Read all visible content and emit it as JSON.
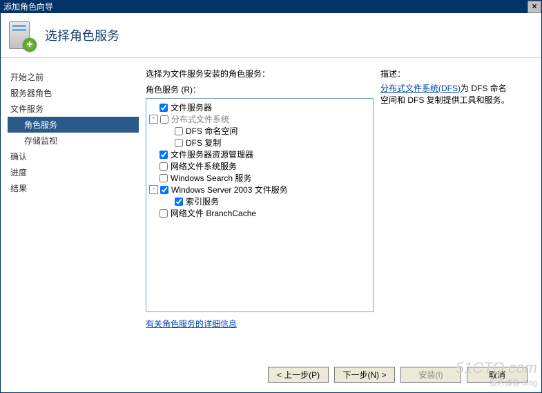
{
  "titlebar": {
    "text": "添加角色向导"
  },
  "header": {
    "title": "选择角色服务"
  },
  "sidebar": {
    "items": [
      {
        "label": "开始之前",
        "indent": false,
        "selected": false
      },
      {
        "label": "服务器角色",
        "indent": false,
        "selected": false
      },
      {
        "label": "文件服务",
        "indent": false,
        "selected": false
      },
      {
        "label": "角色服务",
        "indent": true,
        "selected": true
      },
      {
        "label": "存储监视",
        "indent": true,
        "selected": false
      },
      {
        "label": "确认",
        "indent": false,
        "selected": false
      },
      {
        "label": "进度",
        "indent": false,
        "selected": false
      },
      {
        "label": "结果",
        "indent": false,
        "selected": false
      }
    ]
  },
  "main": {
    "instruction": "选择为文件服务安装的角色服务：",
    "sublabel": "角色服务 (R)：",
    "tree": [
      {
        "indent": 0,
        "expander": "",
        "checked": true,
        "gray": false,
        "label": "文件服务器"
      },
      {
        "indent": 0,
        "expander": "-",
        "checked": false,
        "gray": true,
        "label": "分布式文件系统"
      },
      {
        "indent": 1,
        "expander": "",
        "checked": false,
        "gray": false,
        "label": "DFS 命名空间"
      },
      {
        "indent": 1,
        "expander": "",
        "checked": false,
        "gray": false,
        "label": "DFS 复制"
      },
      {
        "indent": 0,
        "expander": "",
        "checked": true,
        "gray": false,
        "label": "文件服务器资源管理器"
      },
      {
        "indent": 0,
        "expander": "",
        "checked": false,
        "gray": false,
        "label": "网络文件系统服务"
      },
      {
        "indent": 0,
        "expander": "",
        "checked": false,
        "gray": false,
        "label": "Windows Search 服务"
      },
      {
        "indent": 0,
        "expander": "-",
        "checked": true,
        "gray": false,
        "label": "Windows Server 2003 文件服务"
      },
      {
        "indent": 1,
        "expander": "",
        "checked": true,
        "gray": false,
        "label": "索引服务"
      },
      {
        "indent": 0,
        "expander": "",
        "checked": false,
        "gray": false,
        "label": "网络文件 BranchCache"
      }
    ],
    "detail_link": "有关角色服务的详细信息"
  },
  "description": {
    "title": "描述：",
    "link": "分布式文件系统(DFS)",
    "rest1": "为 DFS 命名",
    "rest2": "空间和 DFS 复制提供工具和服务。"
  },
  "buttons": {
    "prev": "< 上一步(P)",
    "next": "下一步(N) >",
    "install": "安装(I)",
    "cancel": "取消"
  },
  "watermark": {
    "line1": "51CTO.com",
    "line2": "技术博客  Blog"
  }
}
